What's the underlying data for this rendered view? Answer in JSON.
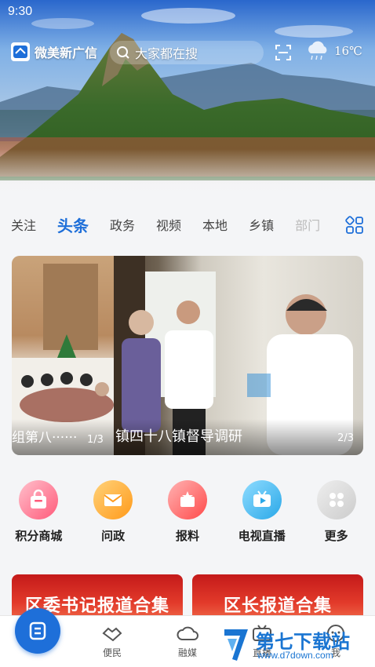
{
  "status_bar": {
    "time": "9:30"
  },
  "header": {
    "brand_name": "微美新广信",
    "search_placeholder": "大家都在搜",
    "weather_icon": "cloud-rain-icon",
    "temperature": "16℃"
  },
  "tabs": [
    {
      "label": "关注",
      "active": false
    },
    {
      "label": "头条",
      "active": true
    },
    {
      "label": "政务",
      "active": false
    },
    {
      "label": "视频",
      "active": false
    },
    {
      "label": "本地",
      "active": false
    },
    {
      "label": "乡镇",
      "active": false
    },
    {
      "label": "部门",
      "active": false
    }
  ],
  "carousel": {
    "slide_left_caption": "组第八······",
    "slide_left_count": "1/3",
    "slide_right_caption": "镇四十八镇督导调研",
    "slide_right_count": "2/3"
  },
  "quick_actions": [
    {
      "label": "积分商城",
      "icon": "shopping-bag-icon",
      "color": "#ff5a7a"
    },
    {
      "label": "问政",
      "icon": "envelope-icon",
      "color": "#ff9a1a"
    },
    {
      "label": "报料",
      "icon": "star-badge-icon",
      "color": "#ff4a4a"
    },
    {
      "label": "电视直播",
      "icon": "tv-play-icon",
      "color": "#2aa8e8"
    },
    {
      "label": "更多",
      "icon": "grid-icon",
      "color": "#cccccc"
    }
  ],
  "promos": [
    {
      "label": "区委书记报道合集"
    },
    {
      "label": "区长报道合集"
    }
  ],
  "bottom_nav": [
    {
      "label": "便民",
      "icon": "handshake-icon"
    },
    {
      "label": "融媒",
      "icon": "cloud-icon"
    },
    {
      "label": "直播",
      "icon": "tv-icon"
    },
    {
      "label": "我",
      "icon": "user-icon"
    }
  ],
  "watermark": {
    "title": "第七下载站",
    "url": "www.d7down.com"
  }
}
